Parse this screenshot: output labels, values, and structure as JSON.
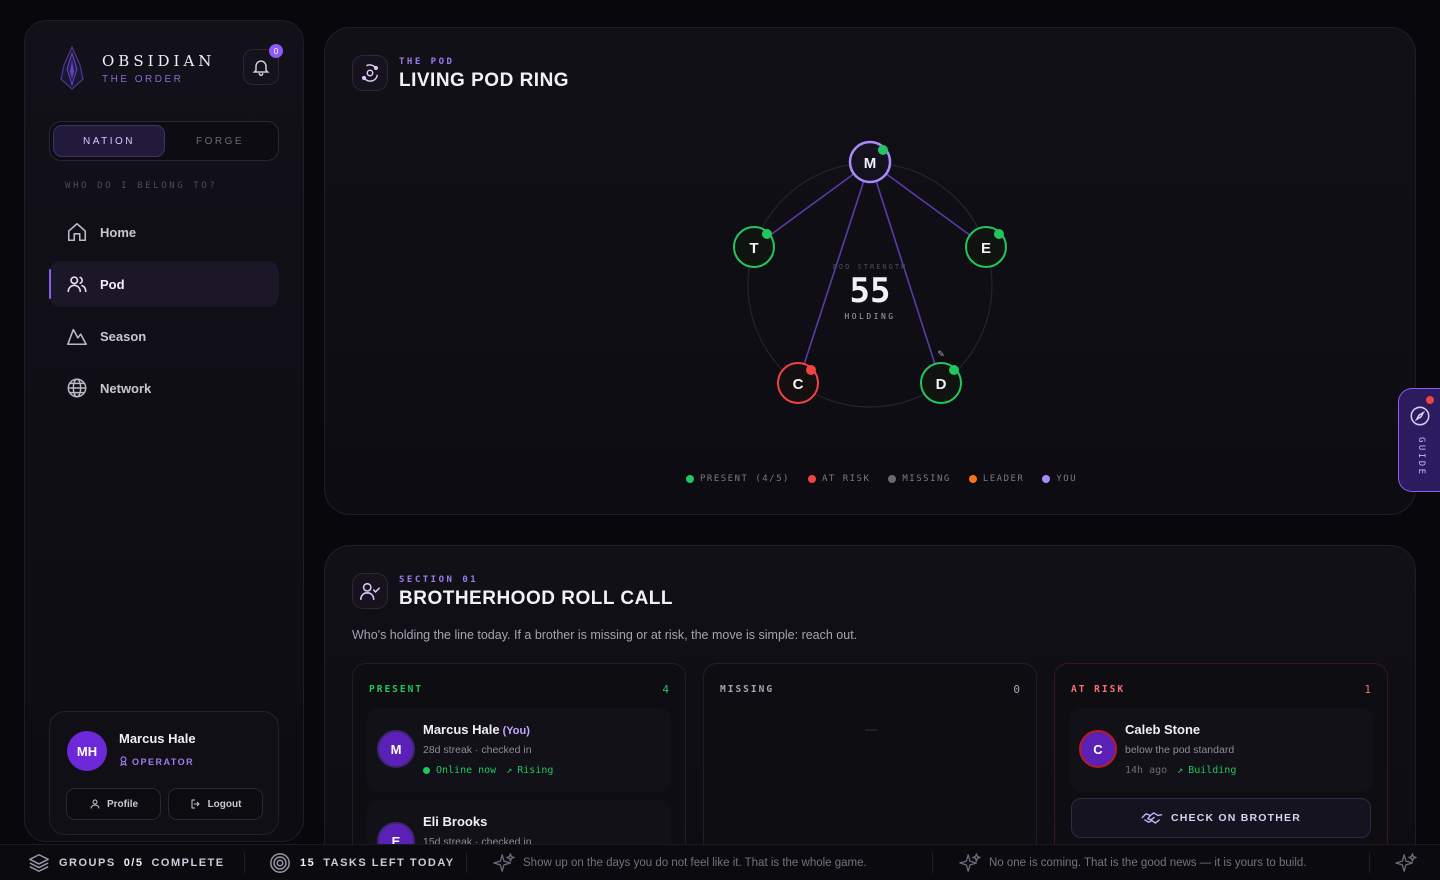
{
  "brand": {
    "title": "OBSIDIAN",
    "subtitle": "THE ORDER"
  },
  "notifications": {
    "count": "0"
  },
  "switcher": {
    "active": "NATION",
    "inactive": "FORGE"
  },
  "sidebar": {
    "section_label": "WHO DO I BELONG TO?",
    "items": [
      {
        "label": "Home",
        "icon": "home-icon"
      },
      {
        "label": "Pod",
        "icon": "users-icon",
        "active": true
      },
      {
        "label": "Season",
        "icon": "mountain-icon"
      },
      {
        "label": "Network",
        "icon": "globe-icon"
      }
    ]
  },
  "user": {
    "initials": "MH",
    "name": "Marcus Hale",
    "role": "OPERATOR",
    "profile_label": "Profile",
    "logout_label": "Logout"
  },
  "pod": {
    "eyebrow": "THE POD",
    "title": "LIVING POD RING",
    "strength_label": "POD STRENGTH",
    "strength_value": "55",
    "strength_status": "HOLDING",
    "members": [
      {
        "letter": "M",
        "status": "present",
        "role": "you"
      },
      {
        "letter": "E",
        "status": "present"
      },
      {
        "letter": "D",
        "status": "present",
        "role": "leader"
      },
      {
        "letter": "C",
        "status": "at-risk"
      },
      {
        "letter": "T",
        "status": "present"
      }
    ],
    "legend": {
      "present": "PRESENT (4/5)",
      "at_risk": "AT RISK",
      "missing": "MISSING",
      "leader": "LEADER",
      "you": "YOU"
    },
    "colors": {
      "present": "#22c55e",
      "at_risk": "#ef4444",
      "missing": "#6b6776",
      "leader": "#f97316",
      "you": "#a78bfa",
      "accent": "#8b5cf6"
    }
  },
  "guide": {
    "label": "GUIDE"
  },
  "roll_call": {
    "eyebrow": "SECTION 01",
    "title": "BROTHERHOOD ROLL CALL",
    "intro": "Who's holding the line today. If a brother is missing or at risk, the move is simple: reach out.",
    "present": {
      "label": "PRESENT",
      "count": "4",
      "members": [
        {
          "initial": "M",
          "name": "Marcus Hale",
          "you_tag": "(You)",
          "detail": "28d streak · checked in",
          "online": "Online now",
          "trend": "Rising"
        },
        {
          "initial": "E",
          "name": "Eli Brooks",
          "detail": "15d streak · checked in"
        }
      ]
    },
    "missing": {
      "label": "MISSING",
      "count": "0",
      "empty": "—"
    },
    "at_risk": {
      "label": "AT RISK",
      "count": "1",
      "members": [
        {
          "initial": "C",
          "name": "Caleb Stone",
          "detail": "below the pod standard",
          "time": "14h ago",
          "trend": "Building"
        }
      ],
      "action_label": "CHECK ON BROTHER"
    }
  },
  "footer": {
    "groups_prefix": "GROUPS",
    "groups_value": "0/5",
    "groups_suffix": "COMPLETE",
    "tasks_value": "15",
    "tasks_suffix": "TASKS LEFT TODAY",
    "quote_1": "Show up on the days you do not feel like it. That is the whole game.",
    "quote_2": "No one is coming. That is the good news — it is yours to build."
  }
}
